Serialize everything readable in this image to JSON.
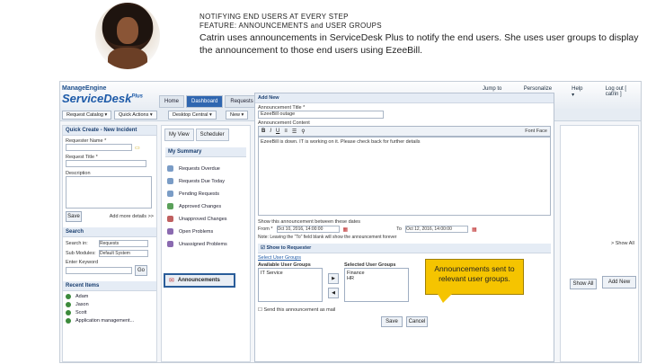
{
  "header": {
    "line1": "NOTIFYING END USERS AT EVERY STEP",
    "line2": "FEATURE: ANNOUNCEMENTS and USER GROUPS",
    "intro": "Catrin uses announcements in ServiceDesk Plus to notify the end users. She uses user groups to display the announcement to those end users using EzeeBill."
  },
  "app": {
    "logo_top": "ManageEngine",
    "logo_main": "ServiceDesk",
    "logo_plus": "Plus",
    "tabs": [
      {
        "label": "Home"
      },
      {
        "label": "Dashboard"
      },
      {
        "label": "Requests"
      }
    ],
    "toplinks": [
      "Jump to ▾",
      "Personalize",
      "Help ▾",
      "Log out [ catrin ]"
    ],
    "subbuttons": [
      "Request Catalog ▾",
      "Quick Actions ▾",
      "Desktop Central ▾",
      "New ▾"
    ]
  },
  "quick_create": {
    "title": "Quick Create - New Incident",
    "requester_label": "Requester Name *",
    "title_label": "Request Title *",
    "description_label": "Description",
    "save": "Save",
    "more": "Add more details >>"
  },
  "search": {
    "title": "Search",
    "search_in": "Search in:",
    "search_in_val": "Requests",
    "sub_modules": "Sub Modules:",
    "sub_modules_val": "Default System",
    "keyword": "Enter Keyword",
    "go": "Go"
  },
  "recent": {
    "title": "Recent Items",
    "items": [
      "Adam",
      "Jason",
      "Scott",
      "Application management..."
    ]
  },
  "summary": {
    "tab1": "My View",
    "tab2": "Scheduler",
    "heading": "My Summary",
    "items": [
      "Requests Overdue",
      "Requests Due Today",
      "Pending Requests",
      "Approved Changes",
      "Unapproved Changes",
      "Open Problems",
      "Unassigned Problems"
    ],
    "announcements": "Announcements"
  },
  "form": {
    "title": "Add New",
    "ann_title_label": "Announcement Title *",
    "ann_title_val": "EzeeBill outage",
    "ann_content_label": "Announcement Content",
    "body": "EzeeBill is down. IT is working on it. Please check back for further details",
    "fonts": "Font Face",
    "show_label": "Show this announcement between these dates",
    "from": "From *",
    "from_val": "Oct 10, 2016, 14:00:00",
    "to": "To",
    "to_val": "Oct 12, 2016, 14:00:00",
    "note": "Note: Leaving the \"To\" field blank will show the announcement forever",
    "show_to": "Show to Requester",
    "select_groups": "Select User Groups",
    "available": "Available User Groups",
    "available_items": [
      "IT Service"
    ],
    "selected": "Selected User Groups",
    "selected_items": [
      "Finance",
      "HR"
    ],
    "send_mail": "Send this announcement as mail",
    "save": "Save",
    "cancel": "Cancel"
  },
  "right": {
    "show_all": "> Show All",
    "show_all_btn": "Show All",
    "add_new": "Add New"
  },
  "callout": "Announcements sent to relevant user groups."
}
